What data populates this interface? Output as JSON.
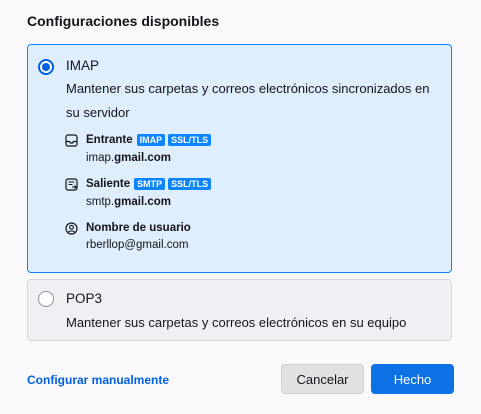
{
  "heading": "Configuraciones disponibles",
  "imap": {
    "title": "IMAP",
    "description": "Mantener sus carpetas y correos electrónicos sincronizados en su servidor",
    "incoming": {
      "label": "Entrante",
      "badges": [
        "IMAP",
        "SSL/TLS"
      ],
      "host_prefix": "imap.",
      "host_domain": "gmail.com"
    },
    "outgoing": {
      "label": "Saliente",
      "badges": [
        "SMTP",
        "SSL/TLS"
      ],
      "host_prefix": "smtp.",
      "host_domain": "gmail.com"
    },
    "username": {
      "label": "Nombre de usuario",
      "value": "rberllop@gmail.com"
    }
  },
  "pop3": {
    "title": "POP3",
    "description": "Mantener sus carpetas y correos electrónicos en su equipo"
  },
  "footer": {
    "manual_link": "Configurar manualmente",
    "cancel_label": "Cancelar",
    "done_label": "Hecho"
  },
  "colors": {
    "accent": "#0a84ff",
    "selected_bg": "#deeefc",
    "link": "#0060df",
    "done_button": "#0b71e4"
  },
  "icons": {
    "incoming": "inbox-icon",
    "outgoing": "outbox-icon",
    "username": "user-icon"
  }
}
